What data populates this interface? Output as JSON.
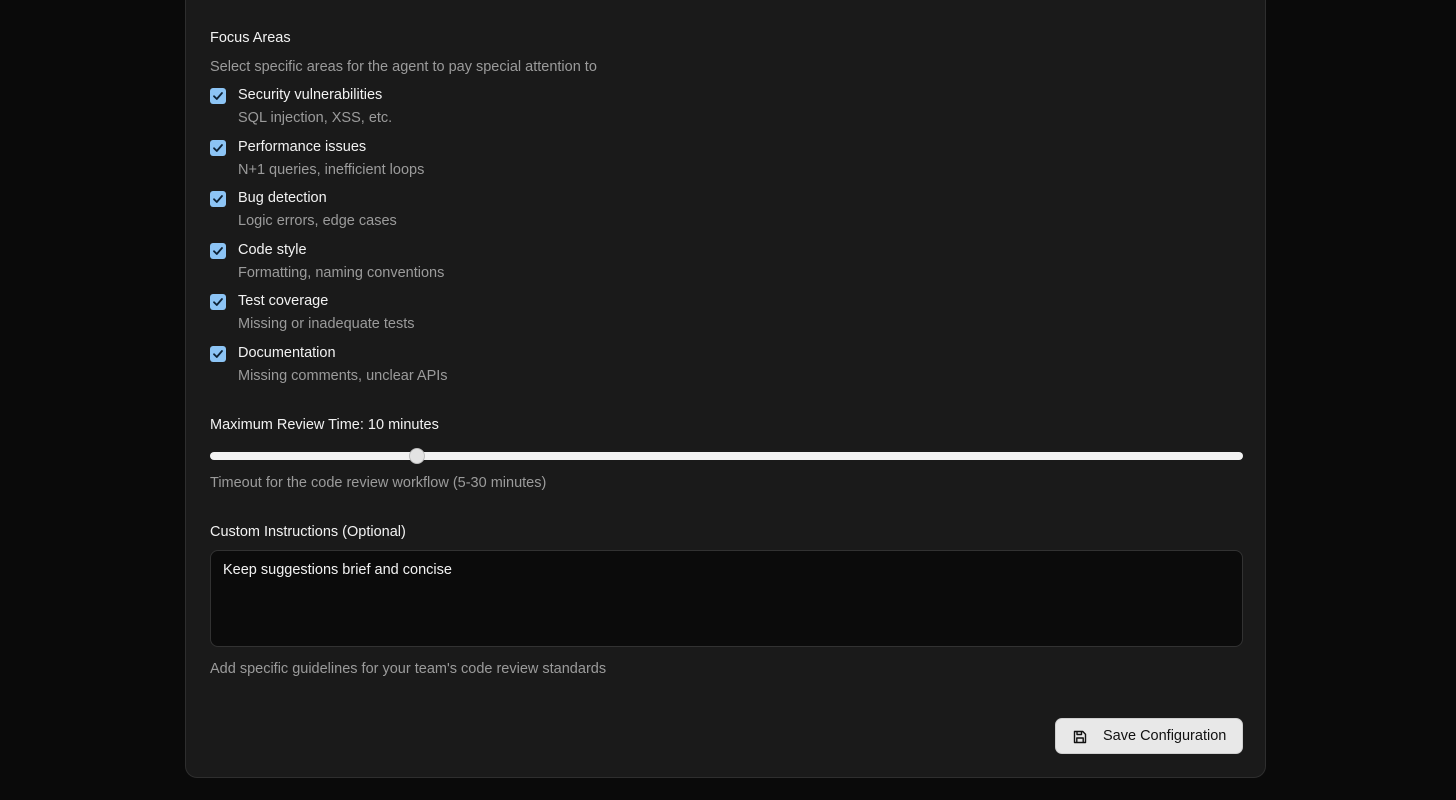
{
  "focus_areas": {
    "title": "Focus Areas",
    "subtitle": "Select specific areas for the agent to pay special attention to",
    "items": [
      {
        "label": "Security vulnerabilities",
        "description": "SQL injection, XSS, etc.",
        "checked": true
      },
      {
        "label": "Performance issues",
        "description": "N+1 queries, inefficient loops",
        "checked": true
      },
      {
        "label": "Bug detection",
        "description": "Logic errors, edge cases",
        "checked": true
      },
      {
        "label": "Code style",
        "description": "Formatting, naming conventions",
        "checked": true
      },
      {
        "label": "Test coverage",
        "description": "Missing or inadequate tests",
        "checked": true
      },
      {
        "label": "Documentation",
        "description": "Missing comments, unclear APIs",
        "checked": true
      }
    ]
  },
  "review_time": {
    "label": "Maximum Review Time: 10 minutes",
    "value": 10,
    "min": 5,
    "max": 30,
    "help": "Timeout for the code review workflow (5-30 minutes)"
  },
  "custom_instructions": {
    "label": "Custom Instructions (Optional)",
    "value": "Keep suggestions brief and concise",
    "help": "Add specific guidelines for your team's code review standards"
  },
  "actions": {
    "save_label": "Save Configuration",
    "save_icon": "save-icon"
  },
  "colors": {
    "checkbox": "#8cc4f5",
    "card_background": "#1a1a1a",
    "page_background": "#0a0a0a"
  }
}
